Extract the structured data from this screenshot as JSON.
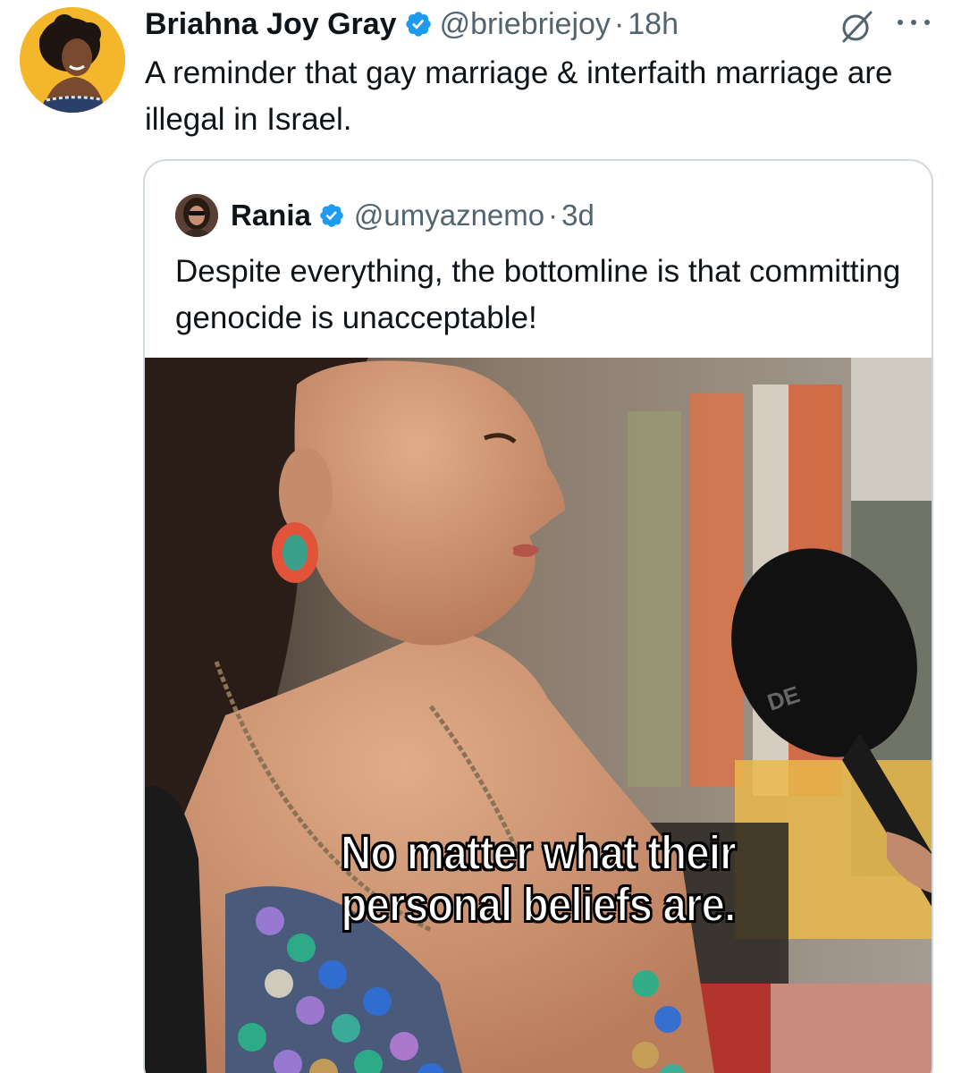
{
  "tweet": {
    "author": {
      "display_name": "Briahna Joy Gray",
      "handle": "@briebriejoy",
      "verified": true,
      "avatar_icon": "profile-photo"
    },
    "separator": "·",
    "timestamp": "18h",
    "text": "A reminder that gay marriage & interfaith marriage are illegal in Israel.",
    "icons": {
      "grok": "grok-icon",
      "more": "more-options-icon"
    }
  },
  "quoted_tweet": {
    "author": {
      "display_name": "Rania",
      "handle": "@umyaznemo",
      "verified": true,
      "avatar_icon": "profile-photo"
    },
    "separator": "·",
    "timestamp": "3d",
    "text": "Despite everything, the bottomline is that committing genocide is unacceptable!",
    "media": {
      "type": "video-frame",
      "caption_line1": "No matter what their",
      "caption_line2": "personal beliefs are."
    }
  },
  "colors": {
    "text_primary": "#0f1419",
    "text_secondary": "#536471",
    "verified_blue": "#1d9bf0",
    "border": "#cfd9de"
  }
}
